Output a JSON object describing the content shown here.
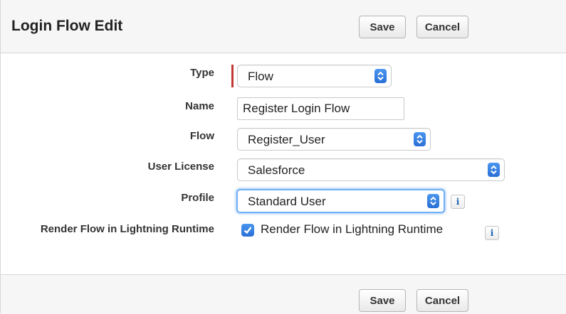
{
  "header": {
    "title": "Login Flow Edit",
    "save_label": "Save",
    "cancel_label": "Cancel"
  },
  "form": {
    "type": {
      "label": "Type",
      "value": "Flow",
      "required": true
    },
    "name": {
      "label": "Name",
      "value": "Register Login Flow"
    },
    "flow": {
      "label": "Flow",
      "value": "Register_User"
    },
    "user_license": {
      "label": "User License",
      "value": "Salesforce"
    },
    "profile": {
      "label": "Profile",
      "value": "Standard User",
      "info": "i"
    },
    "render": {
      "label": "Render Flow in Lightning Runtime",
      "checkbox_label": "Render Flow in Lightning Runtime",
      "checked": true,
      "info": "i"
    }
  },
  "footer": {
    "save_label": "Save",
    "cancel_label": "Cancel"
  },
  "colors": {
    "accent": "#2a6fd6",
    "required": "#c23934",
    "focus": "#6fb0f5"
  },
  "icons": [
    "select-arrows-icon",
    "info-icon",
    "checkmark-icon"
  ]
}
